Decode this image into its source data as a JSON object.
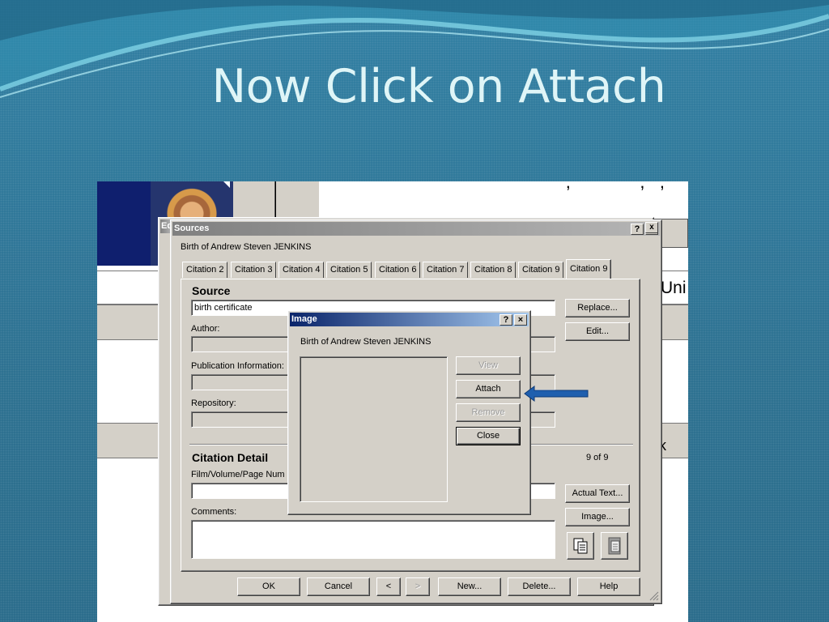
{
  "slide": {
    "title": "Now Click on Attach"
  },
  "background_app": {
    "partial_text_right": "Uni",
    "partial_text_right2": "k",
    "partial_title": "Ed"
  },
  "sources_dialog": {
    "title": "Sources",
    "help_glyph": "?",
    "close_glyph": "×",
    "subject": "Birth of Andrew Steven JENKINS",
    "tabs": [
      "Citation 2",
      "Citation 3",
      "Citation 4",
      "Citation 5",
      "Citation 6",
      "Citation 7",
      "Citation 8",
      "Citation 9",
      "Citation 9"
    ],
    "active_tab_index": 8,
    "source_heading": "Source",
    "source_value": "birth certificate",
    "author_label": "Author:",
    "author_value": "",
    "publication_label": "Publication Information:",
    "publication_value": "",
    "repository_label": "Repository:",
    "repository_value": "",
    "replace_button": "Replace...",
    "edit_button": "Edit...",
    "citation_detail_heading": "Citation Detail",
    "film_label": "Film/Volume/Page Num",
    "film_value": "",
    "comments_label": "Comments:",
    "comments_value": "",
    "counter": "9 of 9",
    "actual_text_button": "Actual Text...",
    "image_button": "Image...",
    "footer": {
      "ok": "OK",
      "cancel": "Cancel",
      "prev": "<",
      "next": ">",
      "new": "New...",
      "delete": "Delete...",
      "help": "Help"
    }
  },
  "image_dialog": {
    "title": "Image",
    "help_glyph": "?",
    "close_glyph": "×",
    "subject": "Birth of Andrew Steven JENKINS",
    "view_button": "View",
    "attach_button": "Attach",
    "remove_button": "Remove",
    "close_button": "Close"
  },
  "icons": {
    "copy": "copy-icon",
    "paste": "paste-icon",
    "arrow": "arrow-left-icon"
  },
  "colors": {
    "title_text": "#dff5f7",
    "slide_bg": "#2a7090",
    "dialog_face": "#d4d0c8",
    "active_title": "#0a246a",
    "arrow": "#1f5fae"
  }
}
